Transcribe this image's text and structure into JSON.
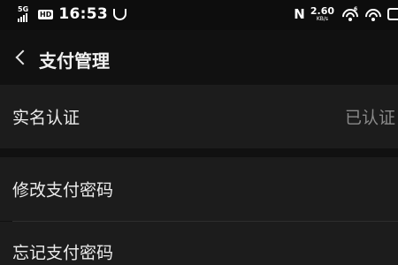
{
  "status_bar": {
    "network": "5G",
    "hd_badge": "HD",
    "time": "16:53",
    "speed_value": "2.60",
    "speed_unit": "KB/s",
    "wifi_tag": "6",
    "nfc_icon": "N"
  },
  "header": {
    "title": "支付管理"
  },
  "rows": [
    {
      "label": "实名认证",
      "value": "已认证"
    },
    {
      "label": "修改支付密码"
    },
    {
      "label": "忘记支付密码"
    }
  ],
  "icons": [
    "signal-icon",
    "hd-icon",
    "app-notification-icon",
    "nfc-icon",
    "wifi-icon",
    "battery-icon",
    "back-icon"
  ],
  "colors": {
    "background": "#111111",
    "row_background": "#1c1c1c",
    "text": "#ececec",
    "muted": "#8a8a8a"
  }
}
